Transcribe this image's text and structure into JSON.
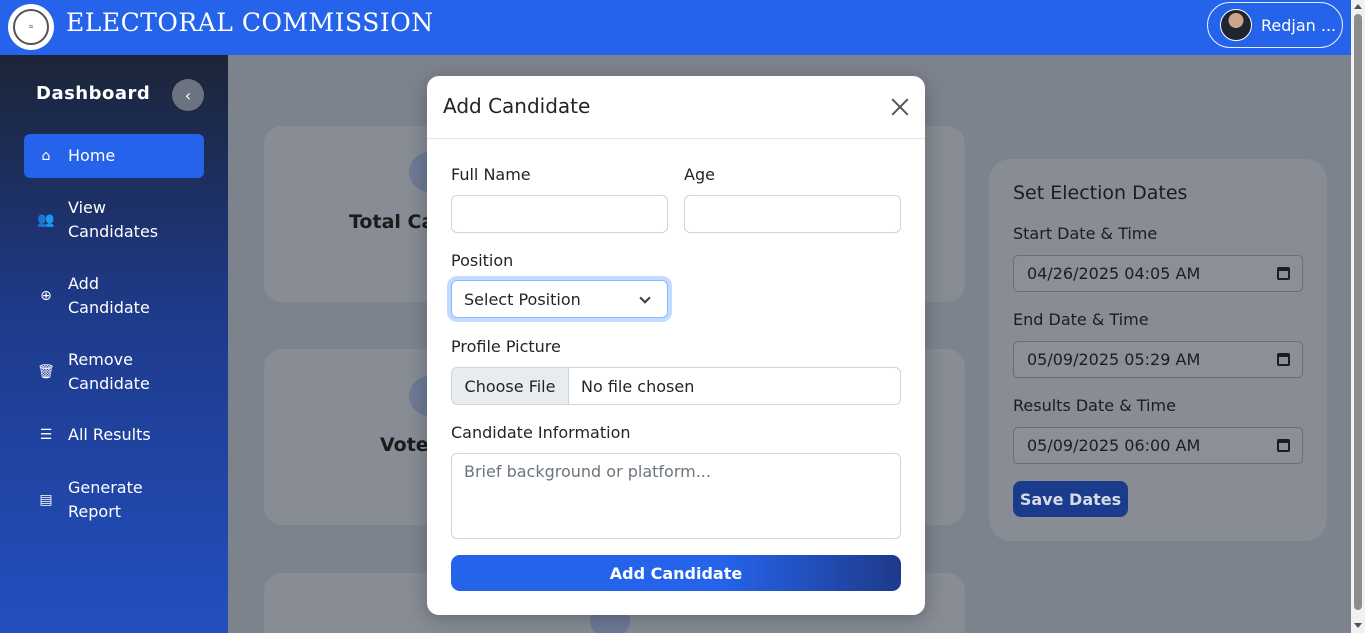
{
  "header": {
    "title": "ELECTORAL COMMISSION",
    "logo_text": "ELECTORAL",
    "user_name": "Redjan ..."
  },
  "sidebar": {
    "title": "Dashboard",
    "items": [
      {
        "label": "Home",
        "icon": "home-icon",
        "active": true
      },
      {
        "label": "View Candidates",
        "icon": "users-icon"
      },
      {
        "label": "Add Candidate",
        "icon": "plus-circle-icon"
      },
      {
        "label": "Remove Candidate",
        "icon": "trash-icon"
      },
      {
        "label": "All Results",
        "icon": "list-icon"
      },
      {
        "label": "Generate Report",
        "icon": "report-icon"
      }
    ]
  },
  "main": {
    "cards": [
      {
        "label": "Total Ca"
      },
      {
        "label": "Vote"
      }
    ],
    "dates": {
      "title": "Set Election Dates",
      "start_label": "Start Date & Time",
      "start_value": "04/26/2025 04:05 AM",
      "end_label": "End Date & Time",
      "end_value": "05/09/2025 05:29 AM",
      "results_label": "Results Date & Time",
      "results_value": "05/09/2025 06:00 AM",
      "save_label": "Save Dates"
    }
  },
  "modal": {
    "title": "Add Candidate",
    "full_name_label": "Full Name",
    "full_name_value": "",
    "age_label": "Age",
    "age_value": "",
    "position_label": "Position",
    "position_value": "Select Position",
    "picture_label": "Profile Picture",
    "file_button": "Choose File",
    "file_status": "No file chosen",
    "info_label": "Candidate Information",
    "info_placeholder": "Brief background or platform...",
    "submit_label": "Add Candidate"
  },
  "colors": {
    "primary": "#2563eb",
    "sidebar_dark": "#1c2438"
  }
}
